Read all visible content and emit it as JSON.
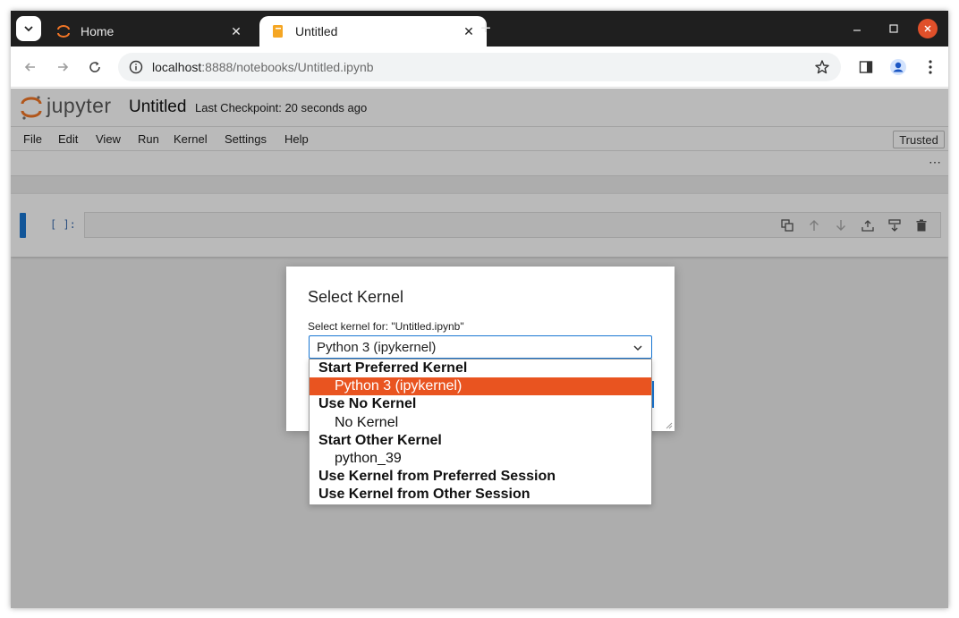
{
  "browser": {
    "tabs": [
      {
        "title": "Home",
        "icon": "jupyter-icon",
        "active": false
      },
      {
        "title": "Untitled",
        "icon": "notebook-icon",
        "active": true
      }
    ],
    "new_tab_label": "+",
    "url_host": "localhost",
    "url_rest": ":8888/notebooks/Untitled.ipynb"
  },
  "notebook": {
    "wordmark": "jupyter",
    "title": "Untitled",
    "checkpoint": "Last Checkpoint: 20 seconds ago",
    "menu": [
      "File",
      "Edit",
      "View",
      "Run",
      "Kernel",
      "Settings",
      "Help"
    ],
    "trusted_label": "Trusted",
    "more_label": "⋯",
    "cell_prompt": "[ ]:"
  },
  "dialog": {
    "title": "Select Kernel",
    "label": "Select kernel for: \"Untitled.ipynb\"",
    "selected_value": "Python 3 (ipykernel)"
  },
  "dropdown": {
    "rows": [
      {
        "text": "Start Preferred Kernel",
        "kind": "group"
      },
      {
        "text": "Python 3 (ipykernel)",
        "kind": "option",
        "selected": true
      },
      {
        "text": "Use No Kernel",
        "kind": "group"
      },
      {
        "text": "No Kernel",
        "kind": "option"
      },
      {
        "text": "Start Other Kernel",
        "kind": "group"
      },
      {
        "text": "python_39",
        "kind": "option"
      },
      {
        "text": "Use Kernel from Preferred Session",
        "kind": "group"
      },
      {
        "text": "Use Kernel from Other Session",
        "kind": "group"
      }
    ]
  },
  "colors": {
    "jupyter_orange": "#f37626",
    "selection": "#e95420",
    "cell_active": "#1976d2",
    "window_close": "#e0502a"
  }
}
